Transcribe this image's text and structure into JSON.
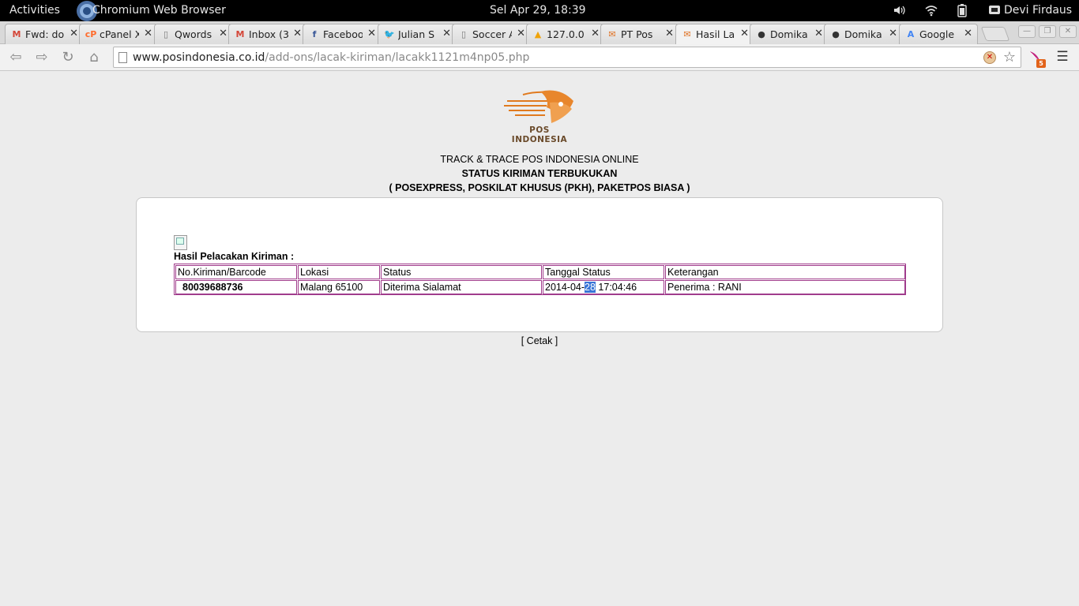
{
  "topbar": {
    "activities": "Activities",
    "app_name": "Chromium Web Browser",
    "clock": "Sel Apr 29, 18:39",
    "volume_icon": "volume-icon",
    "wifi_icon": "wifi-icon",
    "battery_icon": "battery-icon",
    "user_icon": "user-menu-icon",
    "user_name": "Devi Firdaus"
  },
  "tabs": [
    {
      "title": "Fwd: do",
      "icon": "gmail-icon",
      "fav": "M",
      "fav_color": "#d44638"
    },
    {
      "title": "cPanel X",
      "icon": "cpanel-icon",
      "fav": "cP",
      "fav_color": "#ff6c2c"
    },
    {
      "title": "Qwords",
      "icon": "document-icon",
      "fav": "▯",
      "fav_color": "#777777"
    },
    {
      "title": "Inbox (3",
      "icon": "gmail-icon",
      "fav": "M",
      "fav_color": "#d44638"
    },
    {
      "title": "Faceboo",
      "icon": "facebook-icon",
      "fav": "f",
      "fav_color": "#3b5998"
    },
    {
      "title": "Julian S",
      "icon": "twitter-icon",
      "fav": "🐦",
      "fav_color": "#55acee"
    },
    {
      "title": "Soccer A",
      "icon": "document-icon",
      "fav": "▯",
      "fav_color": "#777777"
    },
    {
      "title": "127.0.0",
      "icon": "phpmyadmin-icon",
      "fav": "▲",
      "fav_color": "#f0a30a"
    },
    {
      "title": "PT Pos",
      "icon": "pos-logo-icon",
      "fav": "✉",
      "fav_color": "#e07020"
    },
    {
      "title": "Hasil La",
      "icon": "pos-logo-icon",
      "fav": "✉",
      "fav_color": "#e07020"
    },
    {
      "title": "Domika",
      "icon": "github-icon",
      "fav": "●",
      "fav_color": "#333333"
    },
    {
      "title": "Domika",
      "icon": "github-icon",
      "fav": "●",
      "fav_color": "#333333"
    },
    {
      "title": "Google",
      "icon": "google-translate-icon",
      "fav": "A",
      "fav_color": "#4285f4"
    }
  ],
  "toolbar": {
    "url_host": "www.posindonesia.co.id",
    "url_path": "/add-ons/lacak-kiriman/lacakk1121m4np05.php",
    "ext_badge": "5"
  },
  "page": {
    "logo_text": "POS INDONESIA",
    "heading1": "TRACK & TRACE POS INDONESIA ONLINE",
    "heading2": "STATUS KIRIMAN TERBUKUKAN",
    "heading3": "( POSEXPRESS, POSKILAT KHUSUS (PKH), PAKETPOS BIASA )",
    "result_label": "Hasil Pelacakan Kiriman :",
    "table": {
      "headers": [
        "No.Kiriman/Barcode",
        "Lokasi",
        "Status",
        "Tanggal Status",
        "Keterangan"
      ],
      "rows": [
        {
          "barcode": "80039688736",
          "lokasi": "Malang 65100",
          "status": "Diterima Sialamat",
          "tanggal_before": "2014-04-",
          "tanggal_selected": "28",
          "tanggal_after": " 17:04:46",
          "keterangan": "Penerima : RANI"
        }
      ]
    },
    "cetak": "[ Cetak ]"
  }
}
